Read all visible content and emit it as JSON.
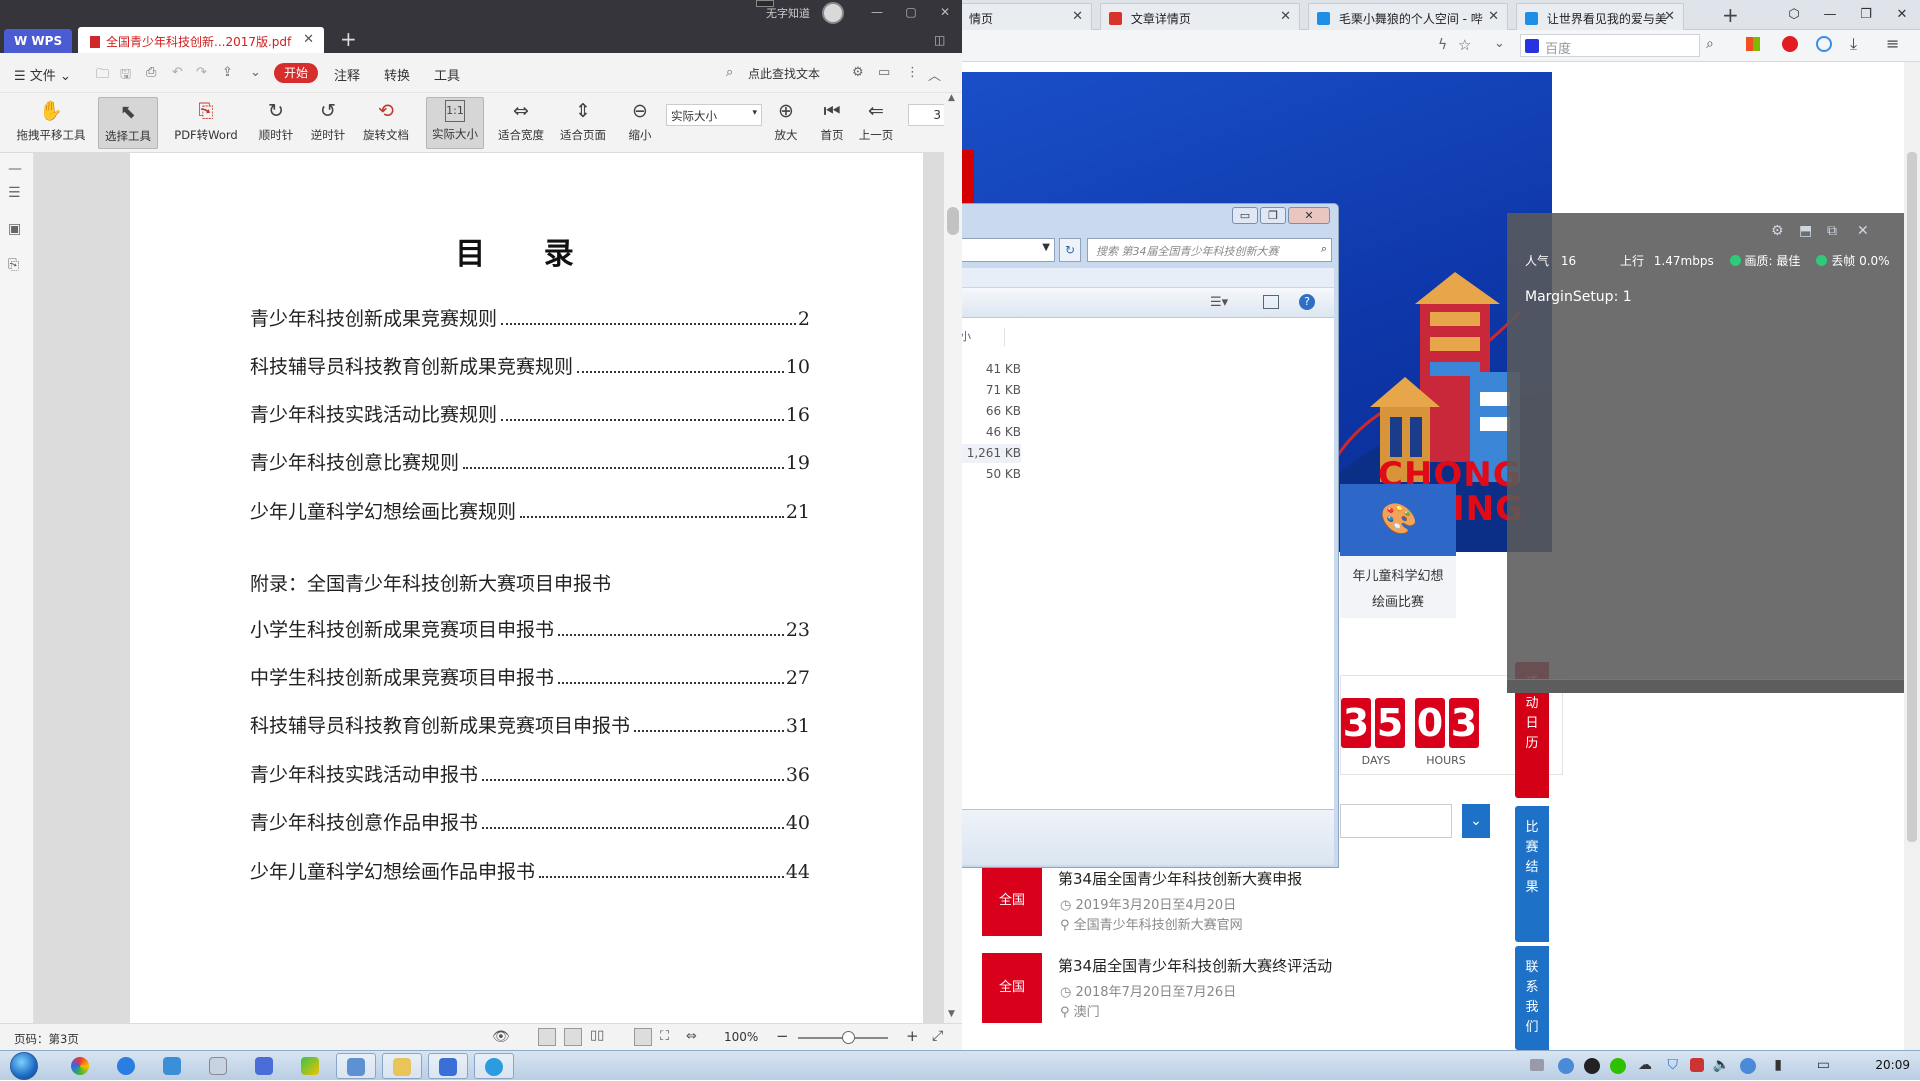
{
  "wps": {
    "app_label": "WPS",
    "doc_tab": "全国青少年科技创新...2017版.pdf",
    "user_name": "无字知道",
    "menu": {
      "file": "文件",
      "start": "开始",
      "annotate": "注释",
      "convert": "转换",
      "tools": "工具",
      "find": "点此查找文本"
    },
    "toolbar": {
      "pan": "拖拽平移工具",
      "select": "选择工具",
      "pdf2word": "PDF转Word",
      "cw": "顺时针",
      "ccw": "逆时针",
      "rotate": "旋转文档",
      "actual": "实际大小",
      "fitwidth": "适合宽度",
      "fitpage": "适合页面",
      "zoomout": "缩小",
      "zoom_value": "实际大小",
      "zoomin": "放大",
      "first": "首页",
      "prev": "上一页",
      "page_value": "3"
    },
    "document": {
      "title": "目  录",
      "entries": [
        {
          "label": "青少年科技创新成果竞赛规则",
          "page": "2"
        },
        {
          "label": "科技辅导员科技教育创新成果竞赛规则",
          "page": "10"
        },
        {
          "label": "青少年科技实践活动比赛规则",
          "page": "16"
        },
        {
          "label": "青少年科技创意比赛规则",
          "page": "19"
        },
        {
          "label": "少年儿童科学幻想绘画比赛规则",
          "page": "21"
        }
      ],
      "appendix": "附录：全国青少年科技创新大赛项目申报书",
      "appendix_entries": [
        {
          "label": "小学生科技创新成果竞赛项目申报书",
          "page": "23"
        },
        {
          "label": "中学生科技创新成果竞赛项目申报书",
          "page": "27"
        },
        {
          "label": "科技辅导员科技教育创新成果竞赛项目申报书",
          "page": "31"
        },
        {
          "label": "青少年科技实践活动申报书",
          "page": "36"
        },
        {
          "label": "青少年科技创意作品申报书",
          "page": "40"
        },
        {
          "label": "少年儿童科学幻想绘画作品申报书",
          "page": "44"
        }
      ]
    },
    "status": {
      "page": "页码：第3页",
      "zoom": "100%"
    }
  },
  "browser": {
    "tabs": [
      {
        "label": "情页",
        "color": "#f0a030"
      },
      {
        "label": "文章详情页",
        "color": "#e8a317"
      },
      {
        "label": "毛栗小舞狼的个人空间 - 哔",
        "color": "#1f8fe5"
      },
      {
        "label": "让世界看见我的爱与美",
        "color": "#1f8fe5"
      }
    ],
    "search_placeholder": "百度",
    "banner_text": "CHONG\nING",
    "paint_card": "年儿童科学幻想\n绘画比赛",
    "countdown": {
      "days": [
        "3",
        "5"
      ],
      "hours": [
        "0",
        "3"
      ],
      "days_label": "DAYS",
      "hours_label": "HOURS"
    },
    "side_tabs": [
      "活动日历",
      "比赛结果",
      "联系我们"
    ],
    "events": [
      {
        "badge": "全国",
        "title": "第34届全国青少年科技创新大赛申报",
        "date": "2019年3月20日至4月20日",
        "place": "全国青少年科技创新大赛官网"
      },
      {
        "badge": "全国",
        "title": "第34届全国青少年科技创新大赛终评活动",
        "date": "2018年7月20日至7月26日",
        "place": "澳门"
      }
    ]
  },
  "explorer": {
    "search_placeholder": "搜索 第34届全国青少年科技创新大赛",
    "column_header": "大小",
    "sizes": [
      "41 KB",
      "71 KB",
      "66 KB",
      "46 KB",
      "1,261 KB",
      "50 KB"
    ]
  },
  "overlay": {
    "popularity_label": "人气",
    "popularity": "16",
    "upload_label": "上行",
    "upload": "1.47mbps",
    "quality_label": "画质:",
    "quality": "最佳",
    "dropped_label": "丢帧",
    "dropped": "0.0%",
    "margin": "MarginSetup: 1"
  },
  "taskbar": {
    "clock": "20:09"
  }
}
